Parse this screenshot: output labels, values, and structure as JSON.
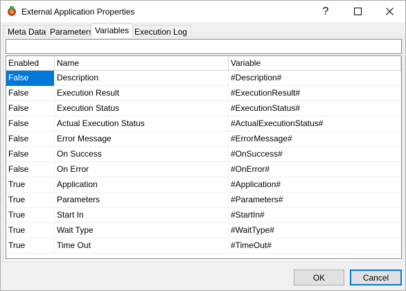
{
  "window": {
    "title": "External Application Properties",
    "help_label": "?",
    "icon": "app-icon"
  },
  "tabs": [
    {
      "label": "Meta Data",
      "active": false
    },
    {
      "label": "Parameters",
      "active": false
    },
    {
      "label": "Variables",
      "active": true
    },
    {
      "label": "Execution Log",
      "active": false
    }
  ],
  "filter": {
    "value": "",
    "placeholder": ""
  },
  "grid": {
    "columns": [
      "Enabled",
      "Name",
      "Variable"
    ],
    "rows": [
      {
        "enabled": "False",
        "name": "Description",
        "variable": "#Description#",
        "selected": true
      },
      {
        "enabled": "False",
        "name": "Execution Result",
        "variable": "#ExecutionResult#"
      },
      {
        "enabled": "False",
        "name": "Execution Status",
        "variable": "#ExecutionStatus#"
      },
      {
        "enabled": "False",
        "name": "Actual Execution Status",
        "variable": "#ActualExecutionStatus#"
      },
      {
        "enabled": "False",
        "name": "Error Message",
        "variable": "#ErrorMessage#"
      },
      {
        "enabled": "False",
        "name": "On Success",
        "variable": "#OnSuccess#"
      },
      {
        "enabled": "False",
        "name": "On Error",
        "variable": "#OnError#"
      },
      {
        "enabled": "True",
        "name": "Application",
        "variable": "#Application#"
      },
      {
        "enabled": "True",
        "name": "Parameters",
        "variable": "#Parameters#"
      },
      {
        "enabled": "True",
        "name": "Start In",
        "variable": "#StartIn#"
      },
      {
        "enabled": "True",
        "name": "Wait Type",
        "variable": "#WaitType#"
      },
      {
        "enabled": "True",
        "name": "Time Out",
        "variable": "#TimeOut#"
      }
    ]
  },
  "buttons": {
    "ok_label": "OK",
    "cancel_label": "Cancel"
  },
  "colors": {
    "selection": "#0078d7",
    "accent_border": "#0078d7"
  }
}
